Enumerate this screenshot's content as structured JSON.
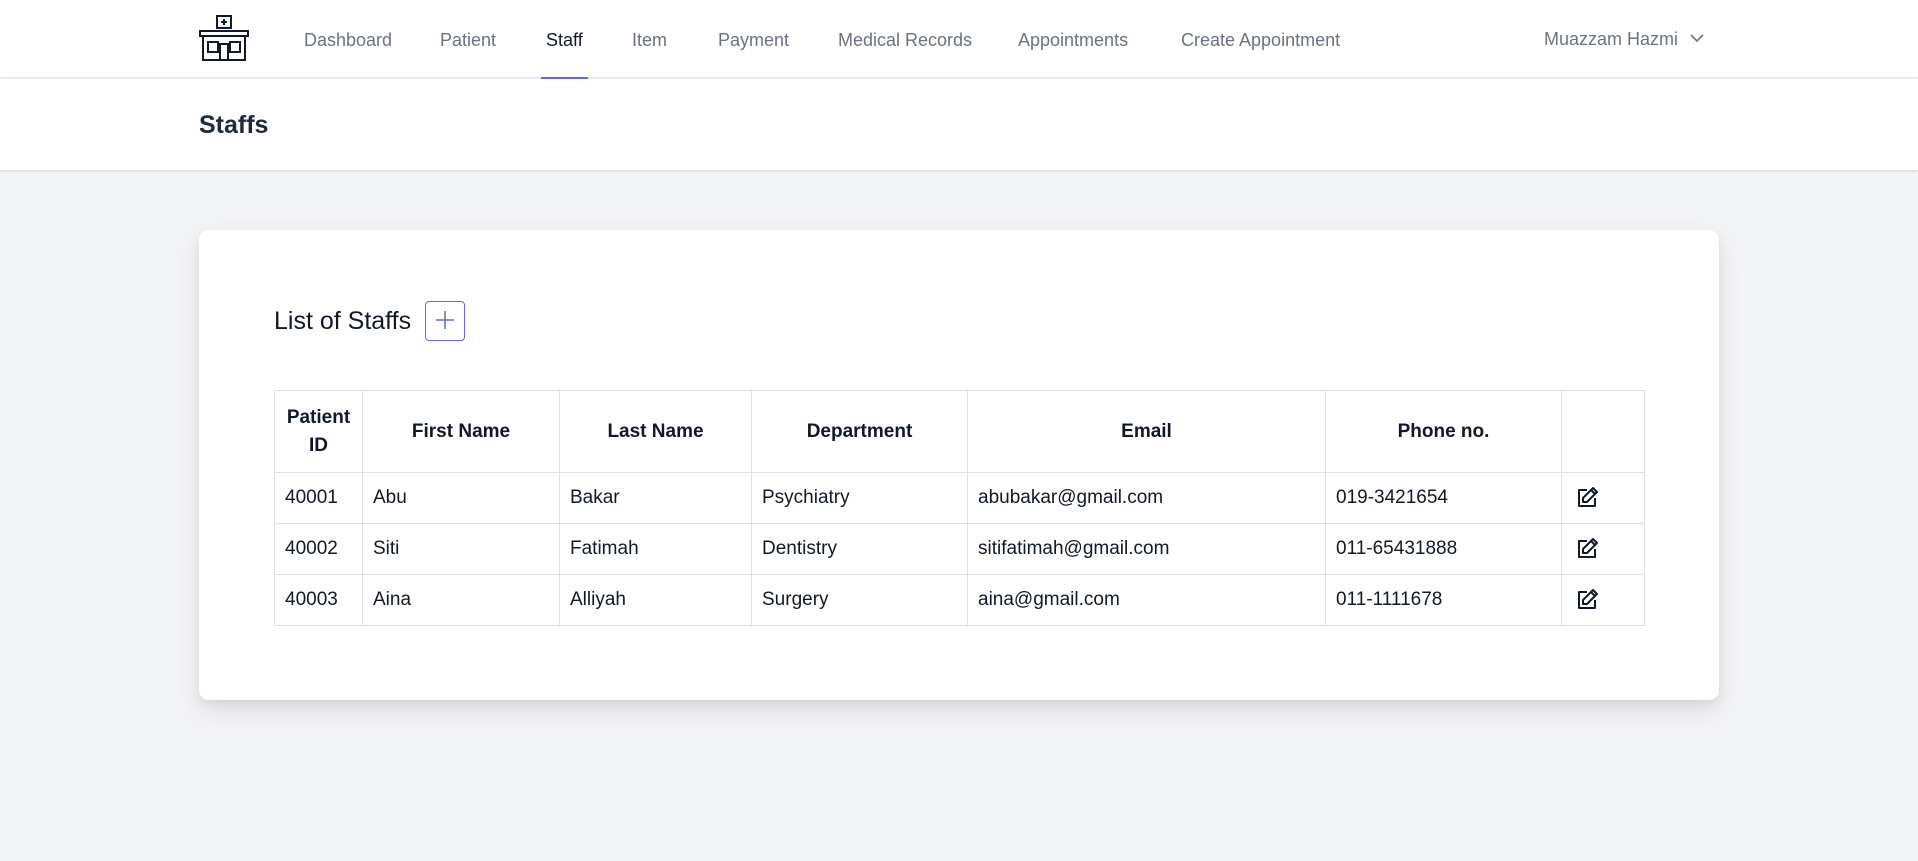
{
  "nav": {
    "items": [
      {
        "label": "Dashboard",
        "active": false
      },
      {
        "label": "Patient",
        "active": false
      },
      {
        "label": "Staff",
        "active": true
      },
      {
        "label": "Item",
        "active": false
      },
      {
        "label": "Payment",
        "active": false
      },
      {
        "label": "Medical Records",
        "active": false
      },
      {
        "label": "Appointments",
        "active": false
      },
      {
        "label": "Create Appointment",
        "active": false
      }
    ],
    "user_name": "Muazzam Hazmi",
    "logo_icon": "hospital-icon",
    "user_menu_icon": "chevron-down-icon",
    "accent_color": "#6366f1"
  },
  "header": {
    "title": "Staffs"
  },
  "card": {
    "title": "List of Staffs",
    "add_icon": "plus-icon"
  },
  "table": {
    "columns": [
      "Patient ID",
      "First Name",
      "Last Name",
      "Department",
      "Email",
      "Phone no.",
      ""
    ],
    "rows": [
      [
        "40001",
        "Abu",
        "Bakar",
        "Psychiatry",
        "abubakar@gmail.com",
        "019-3421654"
      ],
      [
        "40002",
        "Siti",
        "Fatimah",
        "Dentistry",
        "sitifatimah@gmail.com",
        "011-65431888"
      ],
      [
        "40003",
        "Aina",
        "Alliyah",
        "Surgery",
        "aina@gmail.com",
        "011-1111678"
      ]
    ],
    "row_action_icon": "edit-icon"
  }
}
